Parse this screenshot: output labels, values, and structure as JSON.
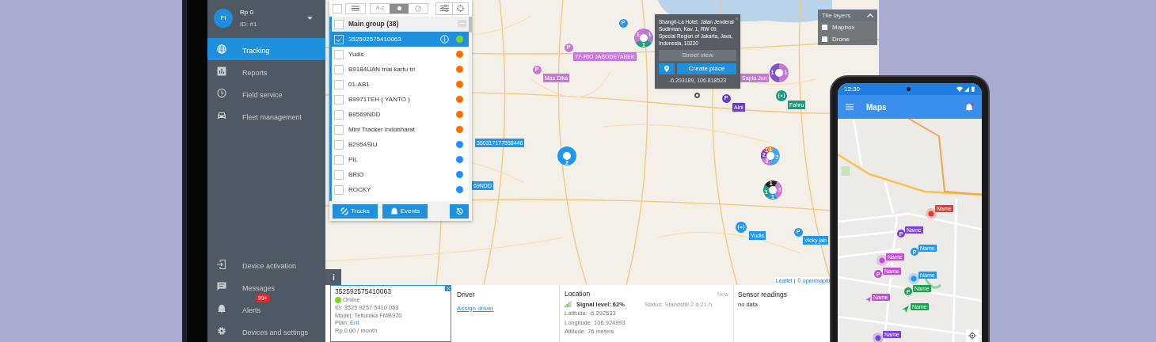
{
  "account": {
    "initials": "FI",
    "balance": "Rp 0",
    "id": "ID: #1"
  },
  "nav": [
    {
      "label": "Tracking",
      "selected": true
    },
    {
      "label": "Reports",
      "selected": false
    },
    {
      "label": "Field service",
      "selected": false
    },
    {
      "label": "Fleet management",
      "selected": false
    }
  ],
  "nav_bottom": [
    {
      "label": "Device activation"
    },
    {
      "label": "Messages"
    },
    {
      "label": "Alerts",
      "badge": "99+"
    },
    {
      "label": "Devices and settings"
    }
  ],
  "device_list": {
    "toolbar": {
      "select_all_checked": false,
      "sort_options": [
        {
          "kind": "alpha",
          "label": "A-z",
          "selected": false
        },
        {
          "kind": "status",
          "selected": true
        },
        {
          "kind": "speed",
          "selected": false
        }
      ]
    },
    "group": {
      "label": "Main group (38)",
      "checked": false
    },
    "devices": [
      {
        "name": "352592575410063",
        "checked": true,
        "selected": true,
        "color": "#7ed321"
      },
      {
        "name": "Yudis",
        "checked": false,
        "selected": false,
        "color": "#ff6d00"
      },
      {
        "name": "B9184UAN trial kartu tri",
        "checked": false,
        "selected": false,
        "color": "#ff6d00"
      },
      {
        "name": "01-AB1",
        "checked": false,
        "selected": false,
        "color": "#ff6d00"
      },
      {
        "name": "B9971TEH ( YANTO )",
        "checked": false,
        "selected": false,
        "color": "#ff6d00"
      },
      {
        "name": "B9569NDD",
        "checked": false,
        "selected": false,
        "color": "#ff6d00"
      },
      {
        "name": "Mini Tracker Indobharat",
        "checked": false,
        "selected": false,
        "color": "#ff6d00"
      },
      {
        "name": "B2954SIU",
        "checked": false,
        "selected": false,
        "color": "#1e90ff"
      },
      {
        "name": "PIL",
        "checked": false,
        "selected": false,
        "color": "#1e90ff"
      },
      {
        "name": "BRIO",
        "checked": false,
        "selected": false,
        "color": "#1e90ff"
      },
      {
        "name": "ROCKY",
        "checked": false,
        "selected": false,
        "color": "#1e90ff"
      }
    ],
    "buttons": [
      {
        "kind": "tracks",
        "label": "Tracks"
      },
      {
        "kind": "events",
        "label": "Events"
      },
      {
        "kind": "history"
      }
    ]
  },
  "map": {
    "markers": [
      {
        "kind": "place",
        "glyph": "P",
        "color": "#2196f3"
      },
      {
        "kind": "cluster",
        "segments": [
          {
            "count": "1",
            "color": "#c678d4"
          },
          {
            "count": "1",
            "color": "#b07cd8"
          },
          {
            "count": "1",
            "color": "#1f9e82"
          }
        ]
      },
      {
        "kind": "place",
        "glyph": "P",
        "color": "#c678d4",
        "label": "TF-RIO JABODETABEK"
      },
      {
        "kind": "place",
        "glyph": "P",
        "color": "#c678d4",
        "label": "Mas Dika"
      },
      {
        "kind": "label",
        "color": "#c678d4",
        "label": "Sapta Jun"
      },
      {
        "kind": "cluster",
        "segments": [
          {
            "count": "1",
            "color": "#7e57c2"
          },
          {
            "count": "1",
            "color": "#c678d4"
          }
        ]
      },
      {
        "kind": "place",
        "glyph": "P",
        "color": "#6a3fc1",
        "label": "Aini"
      },
      {
        "kind": "beacon",
        "color": "#1a9c84",
        "label": "Fahru"
      },
      {
        "kind": "label",
        "color": "#2196f3",
        "label": "350317177558446"
      },
      {
        "kind": "cluster",
        "segments": [
          {
            "count": "2",
            "color": "#2196f3"
          }
        ]
      },
      {
        "kind": "label",
        "color": "#2196f3",
        "label": "69NDD"
      },
      {
        "kind": "cluster",
        "segments": [
          {
            "count": "1",
            "color": "#e53935"
          },
          {
            "count": "1",
            "color": "#fb8c00"
          },
          {
            "count": "2",
            "color": "#6f42c1"
          },
          {
            "count": "7",
            "color": "#42a5f5"
          },
          {
            "count": "3",
            "color": "#c678d4"
          }
        ]
      },
      {
        "kind": "cluster",
        "segments": [
          {
            "count": "1",
            "color": "#222222"
          },
          {
            "count": "1",
            "color": "#1f9e82"
          },
          {
            "count": "3",
            "color": "#c678d4"
          },
          {
            "count": "1",
            "color": "#2196f3"
          }
        ]
      },
      {
        "kind": "beacon",
        "color": "#2196f3",
        "label": "Yudis"
      },
      {
        "kind": "place",
        "glyph": "P",
        "color": "#2196f3",
        "label": "Vicky jab"
      },
      {
        "kind": "pin",
        "color": "#555555"
      }
    ],
    "popup": {
      "address": "Shangri-La Hotel, Jalan Jenderal Sudirman, Kav. 1, RW 09, Special Region of Jakarta, Java, Indonesia, 10220",
      "close": "×",
      "street_view": "Street view",
      "create_place": "Create place",
      "coords": "-6.203189, 106.818523"
    },
    "tile_layers": {
      "title": "Tile layers",
      "options": [
        {
          "label": "Mapbox",
          "checked": false
        },
        {
          "label": "Drone",
          "checked": false
        }
      ]
    },
    "attribution": {
      "link": "Leaflet",
      "separator": "|",
      "text": "© openmaptil"
    }
  },
  "details": {
    "device": {
      "name": "352592575410063",
      "status": "Online",
      "lines": [
        "ID: 3525 9257 5410 063",
        "Model: Teltonika FMB920"
      ],
      "plan_label": "Plan:",
      "plan": "Ent",
      "price": "Rp 0.00 / month"
    },
    "driver": {
      "title": "Driver",
      "link": "Assign driver"
    },
    "location": {
      "title": "Location",
      "time": "Now",
      "signal": "Signal level: 62%",
      "status": "Status: Standstill 2 d 21 h",
      "lines": [
        "Latitude: -6.292533",
        "Longitude: 106.924993",
        "Altitude: 76 meters"
      ]
    },
    "sensors": {
      "title": "Sensor readings",
      "text": "no data"
    }
  },
  "phone": {
    "time": "12:30",
    "title": "Maps",
    "markers": [
      {
        "kind": "beacon",
        "color": "#e53935",
        "label": "Name"
      },
      {
        "kind": "place",
        "glyph": "P",
        "color": "#7b3fe4",
        "label": "Name"
      },
      {
        "kind": "place",
        "glyph": "P",
        "color": "#2196f3",
        "label": "Name"
      },
      {
        "kind": "beacon",
        "color": "#c64bd8",
        "label": "Name"
      },
      {
        "kind": "place",
        "glyph": "P",
        "color": "#c64bd8",
        "label": "Name"
      },
      {
        "kind": "beacon",
        "color": "#2196f3",
        "label": "Name"
      },
      {
        "kind": "place",
        "glyph": "P",
        "color": "#16a34a",
        "label": "Name"
      },
      {
        "kind": "plane",
        "color": "#c64bd8",
        "label": "Name"
      },
      {
        "kind": "arrow",
        "color": "#16a34a",
        "label": "Name"
      },
      {
        "kind": "beacon",
        "color": "#7b3fe4",
        "label": "Name"
      }
    ]
  }
}
